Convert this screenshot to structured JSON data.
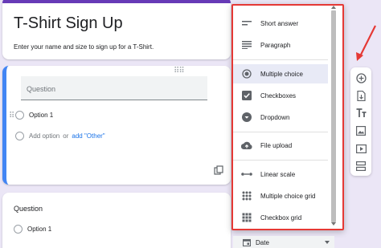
{
  "form": {
    "title": "T-Shirt Sign Up",
    "description": "Enter your name and size to sign up for a T-Shirt."
  },
  "question1": {
    "placeholder": "Question",
    "option1": "Option 1",
    "add_option": "Add option",
    "or": "or",
    "add_other": "add \"Other\""
  },
  "question2": {
    "title": "Question",
    "option1": "Option 1"
  },
  "type_menu": {
    "items": [
      {
        "label": "Short answer",
        "icon": "short-answer-icon"
      },
      {
        "label": "Paragraph",
        "icon": "paragraph-icon"
      },
      {
        "label": "Multiple choice",
        "icon": "radio-icon",
        "selected": true
      },
      {
        "label": "Checkboxes",
        "icon": "checkbox-icon"
      },
      {
        "label": "Dropdown",
        "icon": "dropdown-icon"
      },
      {
        "label": "File upload",
        "icon": "cloud-upload-icon"
      },
      {
        "label": "Linear scale",
        "icon": "linear-scale-icon"
      },
      {
        "label": "Multiple choice grid",
        "icon": "grid-icon"
      },
      {
        "label": "Checkbox grid",
        "icon": "checkbox-grid-icon"
      }
    ],
    "current_selection": "Date"
  },
  "toolbar": {
    "buttons": [
      "add-question-icon",
      "import-questions-icon",
      "add-title-icon",
      "add-image-icon",
      "add-video-icon",
      "add-section-icon"
    ]
  },
  "colors": {
    "accent": "#673ab7",
    "focus_border": "#4285f4",
    "highlight": "#e53935",
    "background": "#ebe6f6"
  }
}
